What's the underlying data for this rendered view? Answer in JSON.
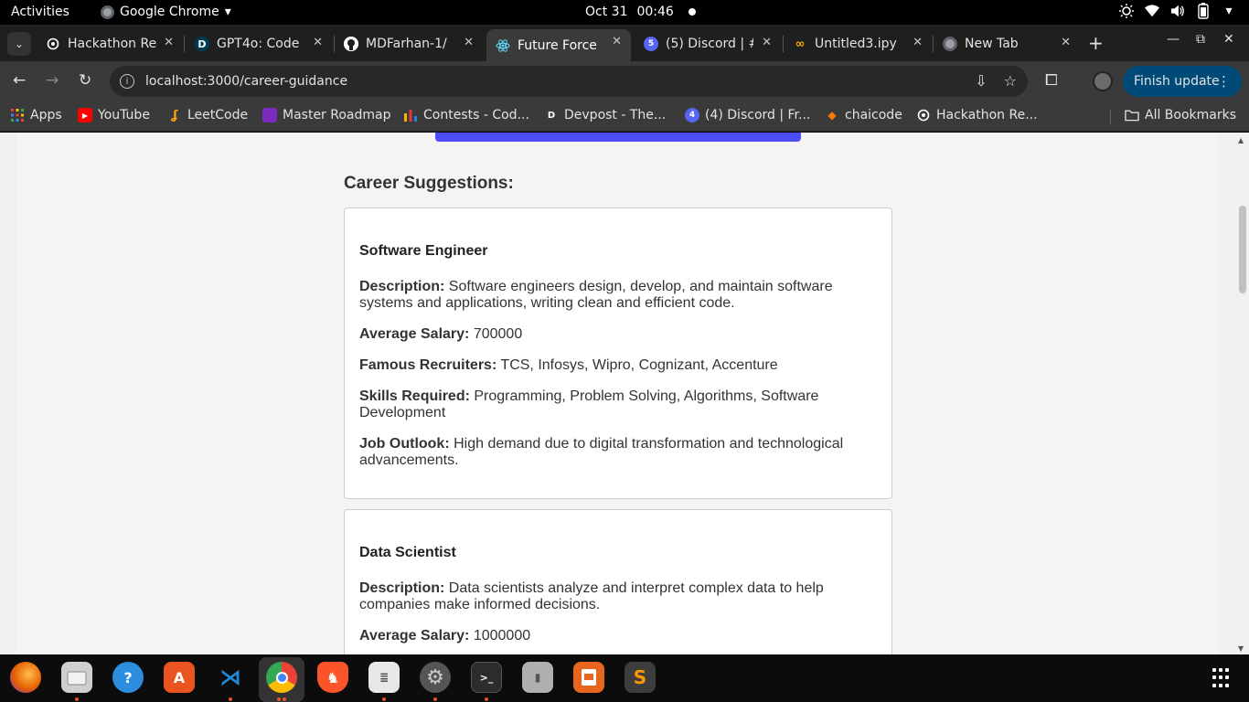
{
  "system": {
    "activities": "Activities",
    "app_name": "Google Chrome",
    "app_arrow": "▾",
    "date": "Oct 31",
    "time": "00:46"
  },
  "tabs": [
    {
      "title": "Hackathon Re",
      "icon": "openai-icon",
      "active": false
    },
    {
      "title": "GPT4o: Code",
      "icon": "devpost-icon",
      "active": false
    },
    {
      "title": "MDFarhan-1/",
      "icon": "github-icon",
      "active": false
    },
    {
      "title": "Future Force",
      "icon": "react-icon",
      "active": true
    },
    {
      "title": "(5) Discord | #",
      "icon": "discord-icon",
      "active": false
    },
    {
      "title": "Untitled3.ipy",
      "icon": "colab-icon",
      "active": false
    },
    {
      "title": "New Tab",
      "icon": "chrome-icon",
      "active": false
    }
  ],
  "toolbar": {
    "url": "localhost:3000/career-guidance",
    "finish_update": "Finish update"
  },
  "bookmarks": [
    {
      "label": "Apps",
      "icon": "apps-grid-icon"
    },
    {
      "label": "YouTube",
      "icon": "youtube-icon"
    },
    {
      "label": "LeetCode",
      "icon": "leetcode-icon"
    },
    {
      "label": "Master Roadmap",
      "icon": "roadmap-icon"
    },
    {
      "label": "Contests - Cod...",
      "icon": "codechef-icon"
    },
    {
      "label": "Devpost - The...",
      "icon": "devpost-icon"
    },
    {
      "label": "(4) Discord | Fr...",
      "icon": "discord-icon"
    },
    {
      "label": "chaicode",
      "icon": "chaicode-icon"
    },
    {
      "label": "Hackathon Re...",
      "icon": "openai-icon"
    },
    {
      "label": "All Bookmarks",
      "icon": "folder-icon"
    }
  ],
  "page": {
    "section_title": "Career Suggestions:",
    "careers": [
      {
        "title": "Software Engineer",
        "description_label": "Description:",
        "description": "Software engineers design, develop, and maintain software systems and applications, writing clean and efficient code.",
        "salary_label": "Average Salary:",
        "salary": "700000",
        "recruiters_label": "Famous Recruiters:",
        "recruiters": "TCS, Infosys, Wipro, Cognizant, Accenture",
        "skills_label": "Skills Required:",
        "skills": "Programming, Problem Solving, Algorithms, Software Development",
        "outlook_label": "Job Outlook:",
        "outlook": "High demand due to digital transformation and technological advancements."
      },
      {
        "title": "Data Scientist",
        "description_label": "Description:",
        "description": "Data scientists analyze and interpret complex data to help companies make informed decisions.",
        "salary_label": "Average Salary:",
        "salary": "1000000"
      }
    ]
  },
  "dock": [
    {
      "name": "firefox-icon",
      "color": "#e66000"
    },
    {
      "name": "files-icon",
      "color": "#cfcfcf"
    },
    {
      "name": "help-icon",
      "color": "#2d8ee0"
    },
    {
      "name": "app-center-icon",
      "color": "#e95420"
    },
    {
      "name": "vscode-icon",
      "color": "#1f88d8"
    },
    {
      "name": "chrome-icon",
      "color": "#34a853"
    },
    {
      "name": "brave-icon",
      "color": "#fb542b"
    },
    {
      "name": "text-editor-icon",
      "color": "#e8e8e8"
    },
    {
      "name": "settings-icon",
      "color": "#9a9a9a"
    },
    {
      "name": "terminal-icon",
      "color": "#2c2c2c"
    },
    {
      "name": "archive-icon",
      "color": "#b0b0b0"
    },
    {
      "name": "impress-icon",
      "color": "#e8651d"
    },
    {
      "name": "sublime-icon",
      "color": "#ff9800"
    }
  ]
}
